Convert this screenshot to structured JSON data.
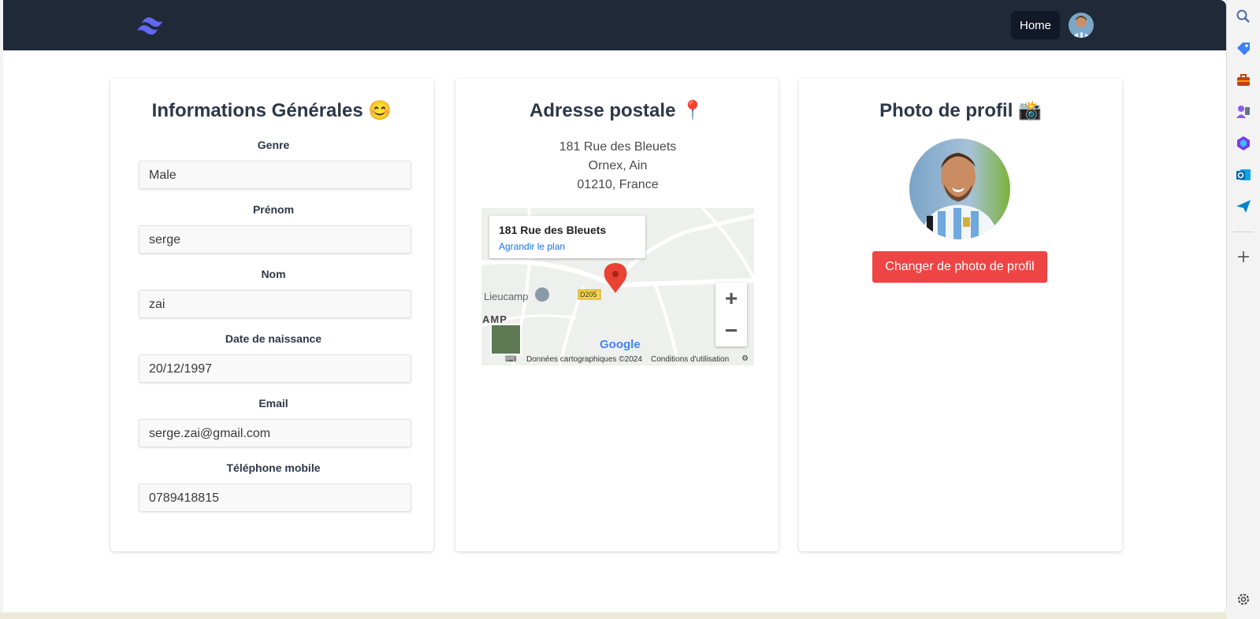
{
  "nav": {
    "home_label": "Home",
    "logo_icon": "tailwind-logo-icon"
  },
  "general": {
    "title": "Informations Générales",
    "emoji": "😊",
    "fields": [
      {
        "label": "Genre",
        "value": "Male"
      },
      {
        "label": "Prénom",
        "value": "serge"
      },
      {
        "label": "Nom",
        "value": "zai"
      },
      {
        "label": "Date de naissance",
        "value": "20/12/1997"
      },
      {
        "label": "Email",
        "value": "serge.zai@gmail.com"
      },
      {
        "label": "Téléphone mobile",
        "value": "0789418815"
      }
    ]
  },
  "address": {
    "title": "Adresse postale",
    "emoji": "📍",
    "line1": "181 Rue des Bleuets",
    "line2": "Ornex, Ain",
    "line3": "01210, France",
    "map": {
      "popup_title": "181 Rue des Bleuets",
      "popup_link": "Agrandir le plan",
      "place_label": "Lieucamp",
      "road_label": "D205",
      "edge_label": "AMP",
      "brand": "Google",
      "footer_data": "Données cartographiques ©2024",
      "footer_terms": "Conditions d'utilisation",
      "zoom_in": "+",
      "zoom_out": "−"
    }
  },
  "photo": {
    "title": "Photo de profil",
    "emoji": "📸",
    "button_label": "Changer de photo de profil"
  },
  "colors": {
    "topbar": "#1f2937",
    "button_red": "#ef4444",
    "title_text": "#2d3748",
    "link_blue": "#1a73e8"
  },
  "sidebar_icons": [
    "search-icon",
    "tag-icon",
    "briefcase-icon",
    "people-icon",
    "copilot-icon",
    "outlook-icon",
    "send-icon",
    "add-icon",
    "settings-icon"
  ]
}
